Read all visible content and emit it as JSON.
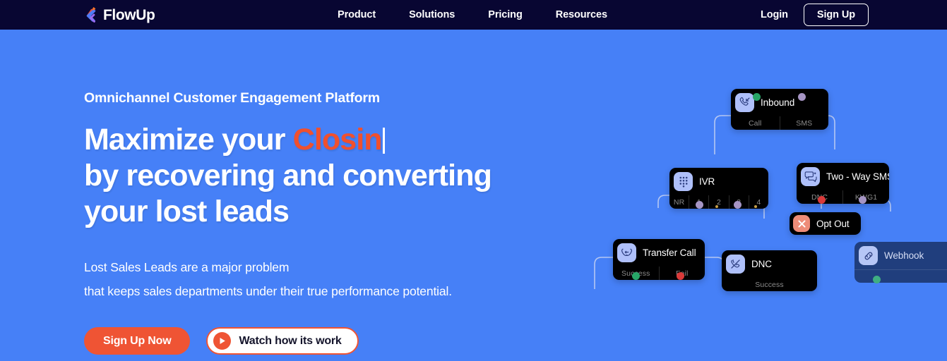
{
  "brand": {
    "name": "FlowUp",
    "logo_icon": "flowup-logo-icon"
  },
  "nav": {
    "links": [
      {
        "label": "Product"
      },
      {
        "label": "Solutions"
      },
      {
        "label": "Pricing"
      },
      {
        "label": "Resources"
      }
    ],
    "login_label": "Login",
    "signup_label": "Sign Up"
  },
  "hero": {
    "eyebrow": "Omnichannel Customer Engagement Platform",
    "headline_part1": "Maximize your ",
    "headline_accent": "Closin",
    "headline_line2": "by recovering and converting",
    "headline_line3": "your lost leads",
    "sub_line1": "Lost Sales Leads are a major problem",
    "sub_line2": "that keeps sales departments under their true performance potential.",
    "cta_primary": "Sign Up Now",
    "cta_video": "Watch how its work",
    "play_icon": "play-icon"
  },
  "colors": {
    "hero_background": "#4680F7",
    "navbar_background": "#080632",
    "accent_orange": "#EF5434",
    "headline_accent": "#F0502E",
    "node_background": "#000000",
    "node_icon_background": "#AFC0FA",
    "danger_icon_background": "#EE8C78",
    "connector": "#C9D4F2",
    "dot_green": "#27A567",
    "dot_red": "#D93A3A",
    "dot_purple": "#A695C4",
    "dot_yellow": "#C8A14A"
  },
  "flow_diagram": {
    "nodes": [
      {
        "id": "inbound",
        "title": "Inbound",
        "icon": "inbound-call-icon",
        "ports": [
          "Call",
          "SMS"
        ],
        "dimmed": false
      },
      {
        "id": "ivr",
        "title": "IVR",
        "icon": "dialpad-icon",
        "ports": [
          "NR",
          "1",
          "2",
          "3",
          "4"
        ],
        "dimmed": false
      },
      {
        "id": "two-way-sms",
        "title": "Two - Way SMS",
        "icon": "chat-bubbles-icon",
        "ports": [
          "DNC",
          "KWG1"
        ],
        "dimmed": false
      },
      {
        "id": "opt-out",
        "title": "Opt Out",
        "icon": "close-x-icon",
        "ports": [],
        "dimmed": false
      },
      {
        "id": "transfer-call",
        "title": "Transfer Call",
        "icon": "transfer-call-icon",
        "ports": [
          "Success",
          "Fail"
        ],
        "dimmed": false
      },
      {
        "id": "dnc",
        "title": "DNC",
        "icon": "phone-blocked-icon",
        "ports": [
          "Success"
        ],
        "dimmed": false
      },
      {
        "id": "webhook",
        "title": "Webhook",
        "icon": "link-chain-icon",
        "ports": [],
        "dimmed": true
      }
    ]
  }
}
